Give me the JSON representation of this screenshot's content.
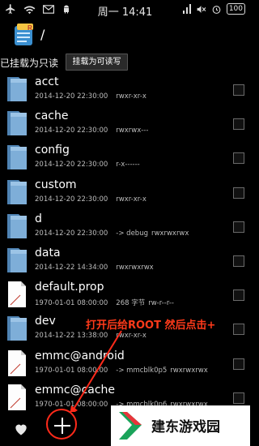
{
  "status_bar": {
    "time": "周一 14:41",
    "battery": "100",
    "icons": [
      "airplane-icon",
      "wifi-icon",
      "mail-icon",
      "android-icon",
      "signal-icon",
      "mute-icon",
      "alarm-icon",
      "battery-icon"
    ]
  },
  "path_bar": {
    "path": "/",
    "icon": "root-explorer-app-icon"
  },
  "mount_bar": {
    "status": "已挂载为只读",
    "button_label": "挂载为可读写"
  },
  "files": [
    {
      "name": "acct",
      "date": "2014-12-20 22:30:00",
      "info": "",
      "perms": "rwxr-xr-x",
      "type": "folder"
    },
    {
      "name": "cache",
      "date": "2014-12-20 22:30:00",
      "info": "",
      "perms": "rwxrwx---",
      "type": "folder"
    },
    {
      "name": "config",
      "date": "2014-12-20 22:30:00",
      "info": "",
      "perms": "r-x------",
      "type": "folder"
    },
    {
      "name": "custom",
      "date": "2014-12-20 22:30:00",
      "info": "",
      "perms": "rwxr-xr-x",
      "type": "folder"
    },
    {
      "name": "d",
      "date": "2014-12-20 22:30:00",
      "info": "-> debug",
      "perms": "rwxrwxrwx",
      "type": "folder"
    },
    {
      "name": "data",
      "date": "2014-12-22 14:34:00",
      "info": "",
      "perms": "rwxrwxrwx",
      "type": "folder"
    },
    {
      "name": "default.prop",
      "date": "1970-01-01 08:00:00",
      "info": "268 字节",
      "perms": "rw-r--r--",
      "type": "file"
    },
    {
      "name": "dev",
      "date": "2014-12-22 13:38:00",
      "info": "",
      "perms": "rwxr-xr-x",
      "type": "folder"
    },
    {
      "name": "emmc@android",
      "date": "1970-01-01 08:00:00",
      "info": "-> mmcblk0p5",
      "perms": "rwxrwxrwx",
      "type": "file"
    },
    {
      "name": "emmc@cache",
      "date": "1970-01-01 08:00:00",
      "info": "-> mmcblk0p6",
      "perms": "rwxrwxrwx",
      "type": "file"
    }
  ],
  "annotation": "打开后给ROOT 然后点击+",
  "bottom_bar": {
    "favorites_icon": "heart-icon",
    "add_icon": "plus-icon"
  },
  "watermark": {
    "text": "建东游戏园"
  },
  "colors": {
    "background": "#000000",
    "folder": "#6f9fc9",
    "annotation": "#ff3a1a"
  }
}
